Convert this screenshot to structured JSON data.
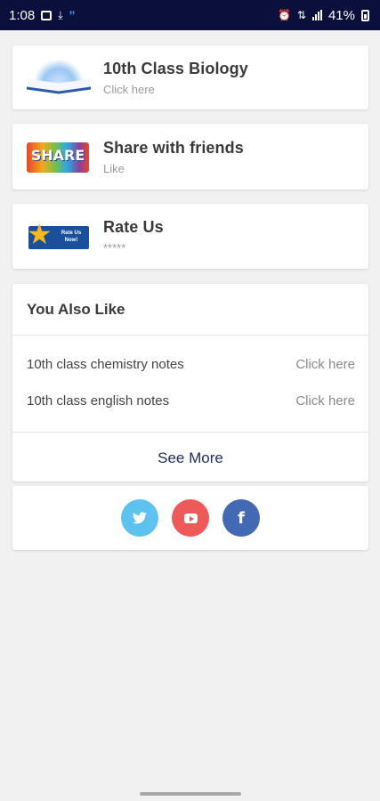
{
  "status_bar": {
    "time": "1:08",
    "battery": "41%"
  },
  "menu": [
    {
      "title": "10th Class Biology",
      "subtitle": "Click here",
      "thumb": "book-icon"
    },
    {
      "title": "Share with friends",
      "subtitle": "Like",
      "thumb": "share-icon",
      "thumb_text": "SHARE"
    },
    {
      "title": "Rate Us",
      "subtitle": "*****",
      "thumb": "rate-us-icon",
      "thumb_text": "Rate Us Now!"
    }
  ],
  "also_like": {
    "title": "You Also Like",
    "items": [
      {
        "label": "10th class chemistry notes",
        "link": "Click here"
      },
      {
        "label": "10th class english notes",
        "link": "Click here"
      }
    ],
    "see_more": "See More"
  },
  "social": {
    "twitter_color": "#5ec2ee",
    "youtube_color": "#ee5a5a",
    "facebook_color": "#4368b4",
    "facebook_glyph": "f"
  }
}
